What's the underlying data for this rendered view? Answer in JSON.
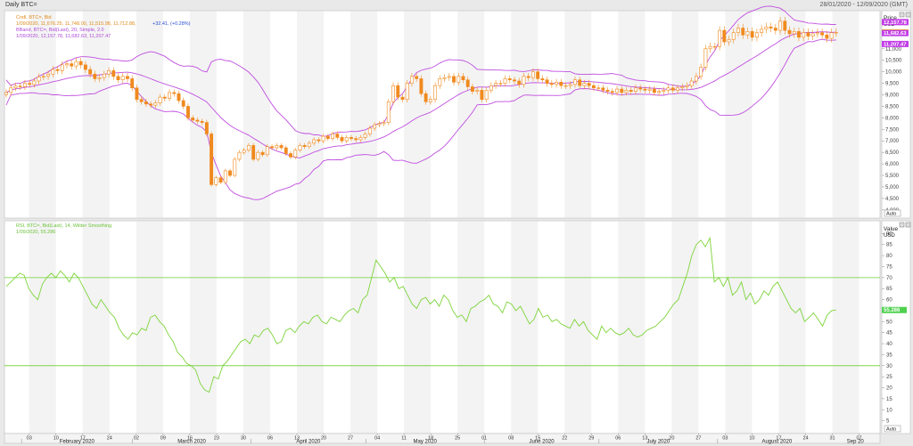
{
  "window": {
    "title": "Daily BTC=",
    "date_range": "28/01/2020 - 12/09/2020 (GMT)"
  },
  "price_panel": {
    "legend_line1": "Cndl, BTC=, Bid",
    "legend_line2a": "1/09/2020, 11,676.25, 11,748.00, 11,515.98, 11,712.88,",
    "legend_line2b": "+32.41, (+0.28%)",
    "legend_line3": "BBand, BTC=, Bid(Last), 20, Simple, 2.0",
    "legend_line4": "1/09/2020, 12,157.78, 11,682.63, 11,207.47",
    "axis_title": "Price",
    "axis_unit": "USD",
    "auto_label": "Auto",
    "flags": {
      "upper": "12,157.78",
      "last": "11,712.88",
      "mid": "11,682.63",
      "lower": "11,207.47"
    },
    "ticks": [
      "11,000",
      "10,500",
      "10,000",
      "9,500",
      "9,000",
      "8,500",
      "8,000",
      "7,500",
      "7,000",
      "6,500",
      "6,000",
      "5,500",
      "5,000",
      "4,500",
      "4,000"
    ]
  },
  "rsi_panel": {
    "legend_line1": "RSI, BTC=, Bid(Last), 14, Wilder Smoothing",
    "legend_line2": "1/09/2020, 55.286",
    "axis_title": "Value",
    "axis_unit": "USD",
    "auto_label": "Auto",
    "flag": "55.286",
    "ticks": [
      "90",
      "85",
      "80",
      "75",
      "70",
      "65",
      "60",
      "55",
      "50",
      "45",
      "40",
      "35",
      "30",
      "25",
      "20",
      "15",
      "10",
      "5"
    ]
  },
  "xaxis": {
    "days": [
      "03",
      "10",
      "17",
      "24",
      "02",
      "09",
      "16",
      "23",
      "30",
      "06",
      "13",
      "20",
      "27",
      "04",
      "11",
      "18",
      "25",
      "01",
      "08",
      "15",
      "22",
      "29",
      "06",
      "13",
      "20",
      "27",
      "03",
      "10",
      "17",
      "24",
      "31",
      "07"
    ],
    "months": [
      "February 2020",
      "March 2020",
      "April 2020",
      "May 2020",
      "June 2020",
      "July 2020",
      "August 2020",
      "Sep 20"
    ]
  },
  "colors": {
    "up": "#f08a1e",
    "down": "#f08a1e",
    "band": "#c04ee0",
    "rsi": "#7dd43a",
    "level": "#6ccf2f",
    "flag_purple": "#c23de8",
    "flag_last": "#f5c518",
    "flag_rsi": "#4fd14f"
  },
  "chart_data": [
    {
      "type": "candlestick",
      "title": "Daily BTC=",
      "ylabel": "Price USD",
      "ylim": [
        3800,
        12500
      ],
      "x_start": "2020-01-28",
      "x_end": "2020-09-12",
      "close": [
        9100,
        9300,
        9380,
        9350,
        9500,
        9450,
        9600,
        9780,
        9800,
        9900,
        10100,
        10050,
        10300,
        10350,
        10250,
        10450,
        10300,
        10100,
        9900,
        9700,
        9750,
        9900,
        10050,
        9800,
        9650,
        9800,
        9700,
        9300,
        8800,
        8700,
        8600,
        8550,
        8650,
        8900,
        8850,
        9100,
        9050,
        8750,
        8500,
        8000,
        7900,
        7850,
        7800,
        7300,
        5100,
        5400,
        5200,
        5700,
        5500,
        6200,
        6500,
        6600,
        6800,
        6200,
        6500,
        6400,
        6750,
        6700,
        6800,
        6700,
        6450,
        6300,
        6600,
        6800,
        6750,
        6900,
        7050,
        7000,
        7200,
        7100,
        7300,
        7150,
        7000,
        7150,
        7100,
        7050,
        7150,
        7300,
        7550,
        7700,
        7750,
        7800,
        8700,
        9400,
        8900,
        8800,
        9500,
        9800,
        9700,
        9050,
        8700,
        8800,
        9400,
        9700,
        9750,
        9800,
        9550,
        9800,
        9650,
        9350,
        9150,
        9200,
        8800,
        9200,
        9400,
        9500,
        9500,
        9700,
        9650,
        9600,
        9450,
        9800,
        9750,
        10000,
        9700,
        9650,
        9500,
        9450,
        9550,
        9400,
        9400,
        9450,
        9650,
        9400,
        9500,
        9400,
        9300,
        9300,
        9200,
        9150,
        9100,
        9250,
        9100,
        9200,
        9150,
        9300,
        9250,
        9200,
        9250,
        9100,
        9150,
        9200,
        9300,
        9200,
        9300,
        9350,
        9400,
        9600,
        9800,
        10200,
        11000,
        11100,
        11100,
        11800,
        11300,
        11400,
        11700,
        11900,
        11600,
        11750,
        11500,
        11700,
        11850,
        11950,
        11900,
        11800,
        12200,
        11800,
        11650,
        11750,
        11500,
        11700,
        11550,
        11650,
        11700,
        11600,
        11450,
        11700,
        11712.88
      ],
      "bollinger": {
        "period": 20,
        "stddev": 2.0,
        "last": {
          "upper": 12157.78,
          "mid": 11682.63,
          "lower": 11207.47
        }
      }
    },
    {
      "type": "line",
      "title": "RSI, BTC=, Bid(Last), 14, Wilder Smoothing",
      "ylim": [
        0,
        95
      ],
      "levels": [
        70,
        30
      ],
      "values": [
        66,
        68,
        70,
        72,
        71,
        65,
        62,
        60,
        67,
        70,
        72,
        70,
        73,
        71,
        68,
        72,
        70,
        66,
        62,
        58,
        56,
        60,
        57,
        54,
        52,
        47,
        44,
        42,
        45,
        44,
        47,
        46,
        52,
        53,
        50,
        48,
        44,
        41,
        36,
        34,
        31,
        30,
        28,
        22,
        19,
        18,
        25,
        24,
        30,
        32,
        35,
        38,
        41,
        42,
        40,
        44,
        43,
        46,
        47,
        44,
        40,
        41,
        46,
        47,
        45,
        48,
        50,
        49,
        52,
        53,
        50,
        49,
        52,
        51,
        50,
        53,
        55,
        56,
        54,
        60,
        62,
        70,
        78,
        75,
        72,
        68,
        70,
        65,
        66,
        62,
        58,
        56,
        60,
        61,
        58,
        60,
        57,
        62,
        60,
        55,
        52,
        53,
        50,
        56,
        57,
        59,
        60,
        62,
        58,
        57,
        54,
        59,
        58,
        55,
        57,
        53,
        49,
        51,
        56,
        52,
        53,
        50,
        51,
        49,
        48,
        47,
        51,
        48,
        50,
        46,
        44,
        42,
        48,
        45,
        47,
        45,
        44,
        45,
        47,
        44,
        43,
        44,
        46,
        47,
        48,
        50,
        52,
        55,
        58,
        60,
        66,
        72,
        80,
        85,
        87,
        84,
        88,
        68,
        70,
        66,
        70,
        62,
        64,
        68,
        60,
        63,
        58,
        60,
        64,
        62,
        66,
        68,
        64,
        60,
        56,
        54,
        56,
        50,
        52,
        54,
        51,
        48,
        53,
        55,
        55.286
      ]
    }
  ]
}
